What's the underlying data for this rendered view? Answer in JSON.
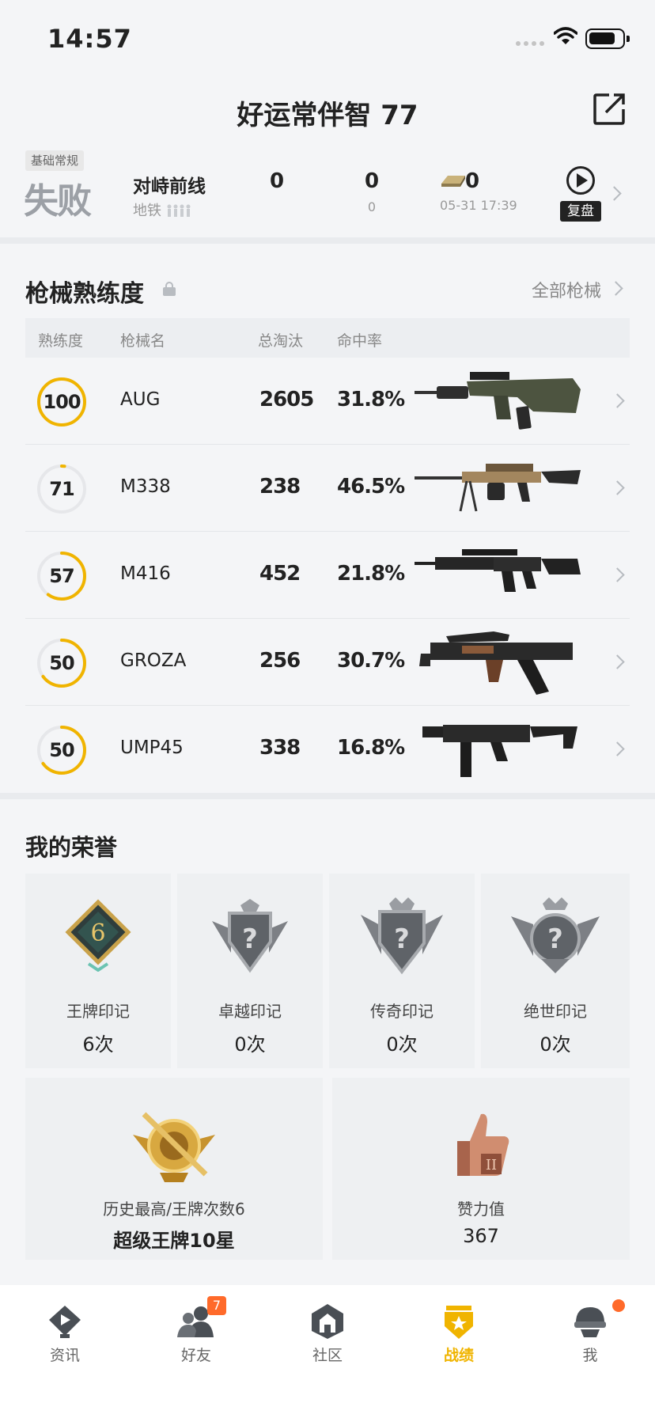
{
  "status_bar": {
    "time": "14:57"
  },
  "header": {
    "title": "好运常伴智 77",
    "share_icon": "share-icon"
  },
  "last_match": {
    "mode_tag": "基础常规",
    "result": "失败",
    "mode_name": "对峙前线",
    "map": "地铁",
    "stat1": "0",
    "stat2_top": "0",
    "stat2_bottom": "0",
    "stat3_top": "0",
    "time": "05-31 17:39",
    "replay_label": "复盘"
  },
  "weapon_section": {
    "title": "枪械熟练度",
    "all_label": "全部枪械",
    "columns": [
      "熟练度",
      "枪械名",
      "总淘汰",
      "命中率"
    ],
    "rows": [
      {
        "level": "100",
        "progress": 1.0,
        "name": "AUG",
        "kills": "2605",
        "hit_rate": "31.8%"
      },
      {
        "level": "71",
        "progress": 0.02,
        "name": "M338",
        "kills": "238",
        "hit_rate": "46.5%"
      },
      {
        "level": "57",
        "progress": 0.6,
        "name": "M416",
        "kills": "452",
        "hit_rate": "21.8%"
      },
      {
        "level": "50",
        "progress": 0.65,
        "name": "GROZA",
        "kills": "256",
        "hit_rate": "30.7%"
      },
      {
        "level": "50",
        "progress": 0.65,
        "name": "UMP45",
        "kills": "338",
        "hit_rate": "16.8%"
      }
    ]
  },
  "honor_section": {
    "title": "我的荣誉",
    "marks": [
      {
        "name": "王牌印记",
        "count": "6次",
        "badge_text": "6"
      },
      {
        "name": "卓越印记",
        "count": "0次",
        "badge_text": "?"
      },
      {
        "name": "传奇印记",
        "count": "0次",
        "badge_text": "?"
      },
      {
        "name": "绝世印记",
        "count": "0次",
        "badge_text": "?"
      }
    ],
    "highest": {
      "label": "历史最高/王牌次数6",
      "value": "超级王牌10星"
    },
    "likes": {
      "label": "赞力值",
      "value": "367"
    }
  },
  "tabbar": {
    "tabs": [
      {
        "label": "资讯",
        "icon": "news-icon"
      },
      {
        "label": "好友",
        "icon": "friends-icon",
        "badge": "7"
      },
      {
        "label": "社区",
        "icon": "community-icon"
      },
      {
        "label": "战绩",
        "icon": "record-icon",
        "active": true
      },
      {
        "label": "我",
        "icon": "profile-icon"
      }
    ]
  },
  "colors": {
    "accent": "#f0b400",
    "ring_track": "#e6e7ea",
    "badge": "#ff6a2a"
  }
}
